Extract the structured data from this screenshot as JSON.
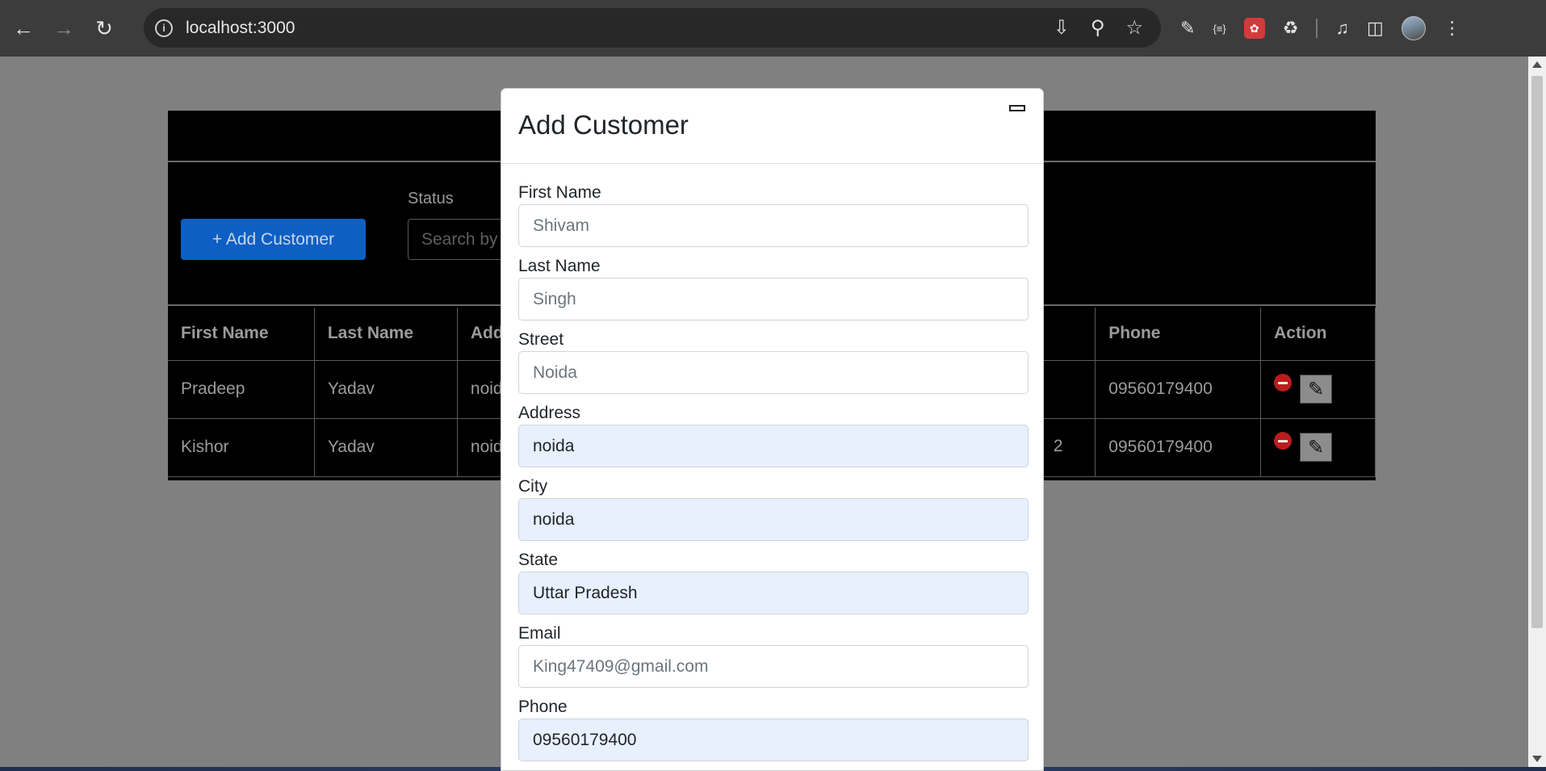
{
  "browser": {
    "url": "localhost:3000"
  },
  "page": {
    "add_button_label": "+ Add Customer",
    "status_label": "Status",
    "search_placeholder": "Search by",
    "table": {
      "headers": [
        "First Name",
        "Last Name",
        "Addre",
        "",
        "Phone",
        "Action"
      ],
      "rows": [
        {
          "first": "Pradeep",
          "last": "Yadav",
          "address": "noida",
          "extra": "",
          "phone": "09560179400"
        },
        {
          "first": "Kishor",
          "last": "Yadav",
          "address": "noida",
          "extra": "2",
          "phone": "09560179400"
        }
      ]
    }
  },
  "modal": {
    "title": "Add Customer",
    "fields": [
      {
        "label": "First Name",
        "value": "Shivam",
        "autofill": false
      },
      {
        "label": "Last Name",
        "value": "Singh",
        "autofill": false
      },
      {
        "label": "Street",
        "value": "Noida",
        "autofill": false
      },
      {
        "label": "Address",
        "value": "noida",
        "autofill": true
      },
      {
        "label": "City",
        "value": "noida",
        "autofill": true
      },
      {
        "label": "State",
        "value": "Uttar Pradesh",
        "autofill": true
      },
      {
        "label": "Email",
        "value": "King47409@gmail.com",
        "autofill": false
      },
      {
        "label": "Phone",
        "value": "09560179400",
        "autofill": true
      }
    ]
  }
}
